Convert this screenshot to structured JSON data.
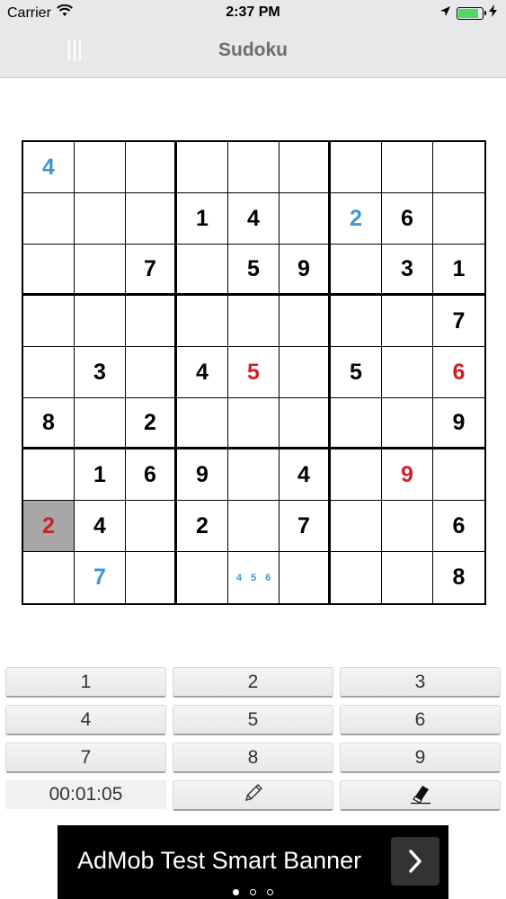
{
  "status_bar": {
    "carrier": "Carrier",
    "time": "2:37 PM",
    "icons": [
      "wifi-icon",
      "location-arrow-icon",
      "battery-icon",
      "charging-bolt-icon"
    ]
  },
  "nav": {
    "title": "Sudoku",
    "menu_icon": "menu-lines-icon"
  },
  "colors": {
    "given": "#000000",
    "user": "#3d97d6",
    "conflict": "#d01f26",
    "selected_bg": "#a7a7a7"
  },
  "board": {
    "rows": [
      [
        {
          "v": "4",
          "t": "user"
        },
        {},
        {},
        {},
        {},
        {},
        {},
        {},
        {}
      ],
      [
        {},
        {},
        {},
        {
          "v": "1",
          "t": "given"
        },
        {
          "v": "4",
          "t": "given"
        },
        {},
        {
          "v": "2",
          "t": "user"
        },
        {
          "v": "6",
          "t": "given"
        },
        {}
      ],
      [
        {},
        {},
        {
          "v": "7",
          "t": "given"
        },
        {},
        {
          "v": "5",
          "t": "given"
        },
        {
          "v": "9",
          "t": "given"
        },
        {},
        {
          "v": "3",
          "t": "given"
        },
        {
          "v": "1",
          "t": "given"
        }
      ],
      [
        {},
        {},
        {},
        {},
        {},
        {},
        {},
        {},
        {
          "v": "7",
          "t": "given"
        }
      ],
      [
        {},
        {
          "v": "3",
          "t": "given"
        },
        {},
        {
          "v": "4",
          "t": "given"
        },
        {
          "v": "5",
          "t": "conflict"
        },
        {},
        {
          "v": "5",
          "t": "given"
        },
        {},
        {
          "v": "6",
          "t": "conflict"
        }
      ],
      [
        {
          "v": "8",
          "t": "given"
        },
        {},
        {
          "v": "2",
          "t": "given"
        },
        {},
        {},
        {},
        {},
        {},
        {
          "v": "9",
          "t": "given"
        }
      ],
      [
        {},
        {
          "v": "1",
          "t": "given"
        },
        {
          "v": "6",
          "t": "given"
        },
        {
          "v": "9",
          "t": "given"
        },
        {},
        {
          "v": "4",
          "t": "given"
        },
        {},
        {
          "v": "9",
          "t": "conflict"
        },
        {}
      ],
      [
        {
          "v": "2",
          "t": "conflict",
          "selected": true
        },
        {
          "v": "4",
          "t": "given"
        },
        {},
        {
          "v": "2",
          "t": "given"
        },
        {},
        {
          "v": "7",
          "t": "given"
        },
        {},
        {},
        {
          "v": "6",
          "t": "given"
        }
      ],
      [
        {},
        {
          "v": "7",
          "t": "user"
        },
        {},
        {},
        {
          "notes": [
            "4",
            "5",
            "6"
          ]
        },
        {},
        {},
        {},
        {
          "v": "8",
          "t": "given"
        }
      ]
    ]
  },
  "keypad": {
    "rows": [
      [
        "1",
        "2",
        "3"
      ],
      [
        "4",
        "5",
        "6"
      ],
      [
        "7",
        "8",
        "9"
      ]
    ],
    "timer": "00:01:05",
    "pencil_icon": "pencil-icon",
    "eraser_icon": "eraser-icon"
  },
  "ad": {
    "text": "AdMob Test Smart Banner",
    "arrow_icon": "chevron-right-icon",
    "pages": 3,
    "active_page": 0
  }
}
